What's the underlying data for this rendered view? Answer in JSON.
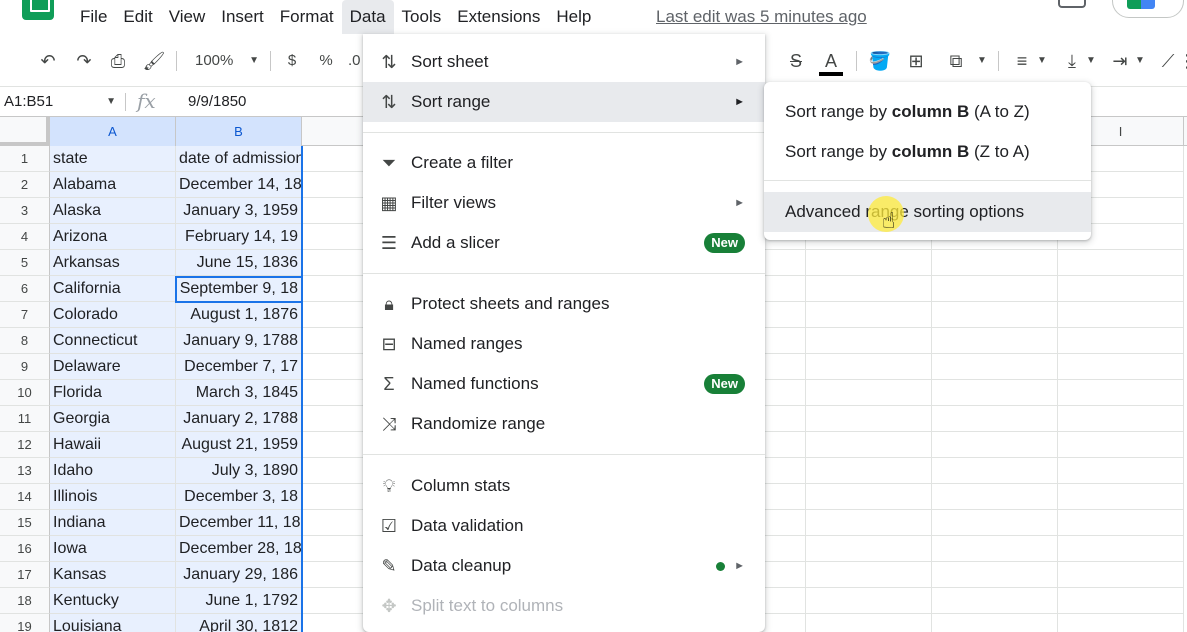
{
  "menubar": {
    "items": [
      "File",
      "Edit",
      "View",
      "Insert",
      "Format",
      "Data",
      "Tools",
      "Extensions",
      "Help"
    ],
    "active": "Data",
    "last_edit": "Last edit was 5 minutes ago"
  },
  "toolbar": {
    "zoom": "100%",
    "currency": "$",
    "percent": "%",
    "decimal": ".0"
  },
  "formula_bar": {
    "name_box": "A1:B51",
    "fx": "fx",
    "value": "9/9/1850"
  },
  "grid": {
    "columns": [
      "A",
      "B",
      "",
      "",
      "",
      "",
      "",
      "",
      "I"
    ],
    "rows": [
      {
        "n": "1",
        "a": "state",
        "b": "date of admission"
      },
      {
        "n": "2",
        "a": "Alabama",
        "b": "December 14, 18"
      },
      {
        "n": "3",
        "a": "Alaska",
        "b": "January 3, 1959"
      },
      {
        "n": "4",
        "a": "Arizona",
        "b": "February 14, 19"
      },
      {
        "n": "5",
        "a": "Arkansas",
        "b": "June 15, 1836"
      },
      {
        "n": "6",
        "a": "California",
        "b": "September 9, 18"
      },
      {
        "n": "7",
        "a": "Colorado",
        "b": "August 1, 1876"
      },
      {
        "n": "8",
        "a": "Connecticut",
        "b": "January 9, 1788"
      },
      {
        "n": "9",
        "a": "Delaware",
        "b": "December 7, 17"
      },
      {
        "n": "10",
        "a": "Florida",
        "b": "March 3, 1845"
      },
      {
        "n": "11",
        "a": "Georgia",
        "b": "January 2, 1788"
      },
      {
        "n": "12",
        "a": "Hawaii",
        "b": "August 21, 1959"
      },
      {
        "n": "13",
        "a": "Idaho",
        "b": "July 3, 1890"
      },
      {
        "n": "14",
        "a": "Illinois",
        "b": "December 3, 18"
      },
      {
        "n": "15",
        "a": "Indiana",
        "b": "December 11, 18"
      },
      {
        "n": "16",
        "a": "Iowa",
        "b": "December 28, 18"
      },
      {
        "n": "17",
        "a": "Kansas",
        "b": "January 29, 186"
      },
      {
        "n": "18",
        "a": "Kentucky",
        "b": "June 1, 1792"
      },
      {
        "n": "19",
        "a": "Louisiana",
        "b": "April 30, 1812"
      }
    ]
  },
  "data_menu": {
    "items": [
      {
        "label": "Sort sheet",
        "icon": "sort-icon",
        "arrow": "►"
      },
      {
        "label": "Sort range",
        "icon": "sort-icon",
        "arrow": "►"
      },
      {
        "label": "Create a filter",
        "icon": "filter-icon"
      },
      {
        "label": "Filter views",
        "icon": "filter-views-icon",
        "arrow": "►"
      },
      {
        "label": "Add a slicer",
        "icon": "slicer-icon",
        "badge": "New"
      },
      {
        "label": "Protect sheets and ranges",
        "icon": "lock-icon"
      },
      {
        "label": "Named ranges",
        "icon": "named-ranges-icon"
      },
      {
        "label": "Named functions",
        "icon": "sigma-icon",
        "badge": "New"
      },
      {
        "label": "Randomize range",
        "icon": "shuffle-icon"
      },
      {
        "label": "Column stats",
        "icon": "lightbulb-icon"
      },
      {
        "label": "Data validation",
        "icon": "data-validation-icon"
      },
      {
        "label": "Data cleanup",
        "icon": "magic-wand-icon",
        "arrow": "►"
      },
      {
        "label": "Split text to columns",
        "icon": "split-icon"
      }
    ]
  },
  "sort_submenu": {
    "by_b_az_prefix": "Sort range by ",
    "by_b_az_bold": "column B",
    "by_b_az_suffix": " (A to Z)",
    "by_b_za_prefix": "Sort range by ",
    "by_b_za_bold": "column B",
    "by_b_za_suffix": " (Z to A)",
    "advanced": "Advanced range sorting options"
  },
  "colors": {
    "accent": "#1a73e8",
    "selection_fill": "#e8f0fe",
    "badge_green": "#188038",
    "cursor_highlight": "#ffeb3b"
  }
}
